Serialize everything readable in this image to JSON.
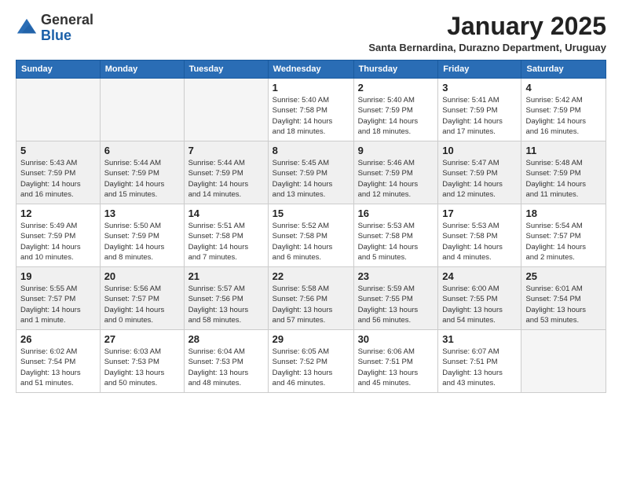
{
  "logo": {
    "general": "General",
    "blue": "Blue"
  },
  "header": {
    "month_title": "January 2025",
    "subtitle": "Santa Bernardina, Durazno Department, Uruguay"
  },
  "days_of_week": [
    "Sunday",
    "Monday",
    "Tuesday",
    "Wednesday",
    "Thursday",
    "Friday",
    "Saturday"
  ],
  "weeks": [
    {
      "shaded": false,
      "days": [
        {
          "day": "",
          "info": ""
        },
        {
          "day": "",
          "info": ""
        },
        {
          "day": "",
          "info": ""
        },
        {
          "day": "1",
          "info": "Sunrise: 5:40 AM\nSunset: 7:58 PM\nDaylight: 14 hours\nand 18 minutes."
        },
        {
          "day": "2",
          "info": "Sunrise: 5:40 AM\nSunset: 7:59 PM\nDaylight: 14 hours\nand 18 minutes."
        },
        {
          "day": "3",
          "info": "Sunrise: 5:41 AM\nSunset: 7:59 PM\nDaylight: 14 hours\nand 17 minutes."
        },
        {
          "day": "4",
          "info": "Sunrise: 5:42 AM\nSunset: 7:59 PM\nDaylight: 14 hours\nand 16 minutes."
        }
      ]
    },
    {
      "shaded": true,
      "days": [
        {
          "day": "5",
          "info": "Sunrise: 5:43 AM\nSunset: 7:59 PM\nDaylight: 14 hours\nand 16 minutes."
        },
        {
          "day": "6",
          "info": "Sunrise: 5:44 AM\nSunset: 7:59 PM\nDaylight: 14 hours\nand 15 minutes."
        },
        {
          "day": "7",
          "info": "Sunrise: 5:44 AM\nSunset: 7:59 PM\nDaylight: 14 hours\nand 14 minutes."
        },
        {
          "day": "8",
          "info": "Sunrise: 5:45 AM\nSunset: 7:59 PM\nDaylight: 14 hours\nand 13 minutes."
        },
        {
          "day": "9",
          "info": "Sunrise: 5:46 AM\nSunset: 7:59 PM\nDaylight: 14 hours\nand 12 minutes."
        },
        {
          "day": "10",
          "info": "Sunrise: 5:47 AM\nSunset: 7:59 PM\nDaylight: 14 hours\nand 12 minutes."
        },
        {
          "day": "11",
          "info": "Sunrise: 5:48 AM\nSunset: 7:59 PM\nDaylight: 14 hours\nand 11 minutes."
        }
      ]
    },
    {
      "shaded": false,
      "days": [
        {
          "day": "12",
          "info": "Sunrise: 5:49 AM\nSunset: 7:59 PM\nDaylight: 14 hours\nand 10 minutes."
        },
        {
          "day": "13",
          "info": "Sunrise: 5:50 AM\nSunset: 7:59 PM\nDaylight: 14 hours\nand 8 minutes."
        },
        {
          "day": "14",
          "info": "Sunrise: 5:51 AM\nSunset: 7:58 PM\nDaylight: 14 hours\nand 7 minutes."
        },
        {
          "day": "15",
          "info": "Sunrise: 5:52 AM\nSunset: 7:58 PM\nDaylight: 14 hours\nand 6 minutes."
        },
        {
          "day": "16",
          "info": "Sunrise: 5:53 AM\nSunset: 7:58 PM\nDaylight: 14 hours\nand 5 minutes."
        },
        {
          "day": "17",
          "info": "Sunrise: 5:53 AM\nSunset: 7:58 PM\nDaylight: 14 hours\nand 4 minutes."
        },
        {
          "day": "18",
          "info": "Sunrise: 5:54 AM\nSunset: 7:57 PM\nDaylight: 14 hours\nand 2 minutes."
        }
      ]
    },
    {
      "shaded": true,
      "days": [
        {
          "day": "19",
          "info": "Sunrise: 5:55 AM\nSunset: 7:57 PM\nDaylight: 14 hours\nand 1 minute."
        },
        {
          "day": "20",
          "info": "Sunrise: 5:56 AM\nSunset: 7:57 PM\nDaylight: 14 hours\nand 0 minutes."
        },
        {
          "day": "21",
          "info": "Sunrise: 5:57 AM\nSunset: 7:56 PM\nDaylight: 13 hours\nand 58 minutes."
        },
        {
          "day": "22",
          "info": "Sunrise: 5:58 AM\nSunset: 7:56 PM\nDaylight: 13 hours\nand 57 minutes."
        },
        {
          "day": "23",
          "info": "Sunrise: 5:59 AM\nSunset: 7:55 PM\nDaylight: 13 hours\nand 56 minutes."
        },
        {
          "day": "24",
          "info": "Sunrise: 6:00 AM\nSunset: 7:55 PM\nDaylight: 13 hours\nand 54 minutes."
        },
        {
          "day": "25",
          "info": "Sunrise: 6:01 AM\nSunset: 7:54 PM\nDaylight: 13 hours\nand 53 minutes."
        }
      ]
    },
    {
      "shaded": false,
      "days": [
        {
          "day": "26",
          "info": "Sunrise: 6:02 AM\nSunset: 7:54 PM\nDaylight: 13 hours\nand 51 minutes."
        },
        {
          "day": "27",
          "info": "Sunrise: 6:03 AM\nSunset: 7:53 PM\nDaylight: 13 hours\nand 50 minutes."
        },
        {
          "day": "28",
          "info": "Sunrise: 6:04 AM\nSunset: 7:53 PM\nDaylight: 13 hours\nand 48 minutes."
        },
        {
          "day": "29",
          "info": "Sunrise: 6:05 AM\nSunset: 7:52 PM\nDaylight: 13 hours\nand 46 minutes."
        },
        {
          "day": "30",
          "info": "Sunrise: 6:06 AM\nSunset: 7:51 PM\nDaylight: 13 hours\nand 45 minutes."
        },
        {
          "day": "31",
          "info": "Sunrise: 6:07 AM\nSunset: 7:51 PM\nDaylight: 13 hours\nand 43 minutes."
        },
        {
          "day": "",
          "info": ""
        }
      ]
    }
  ]
}
